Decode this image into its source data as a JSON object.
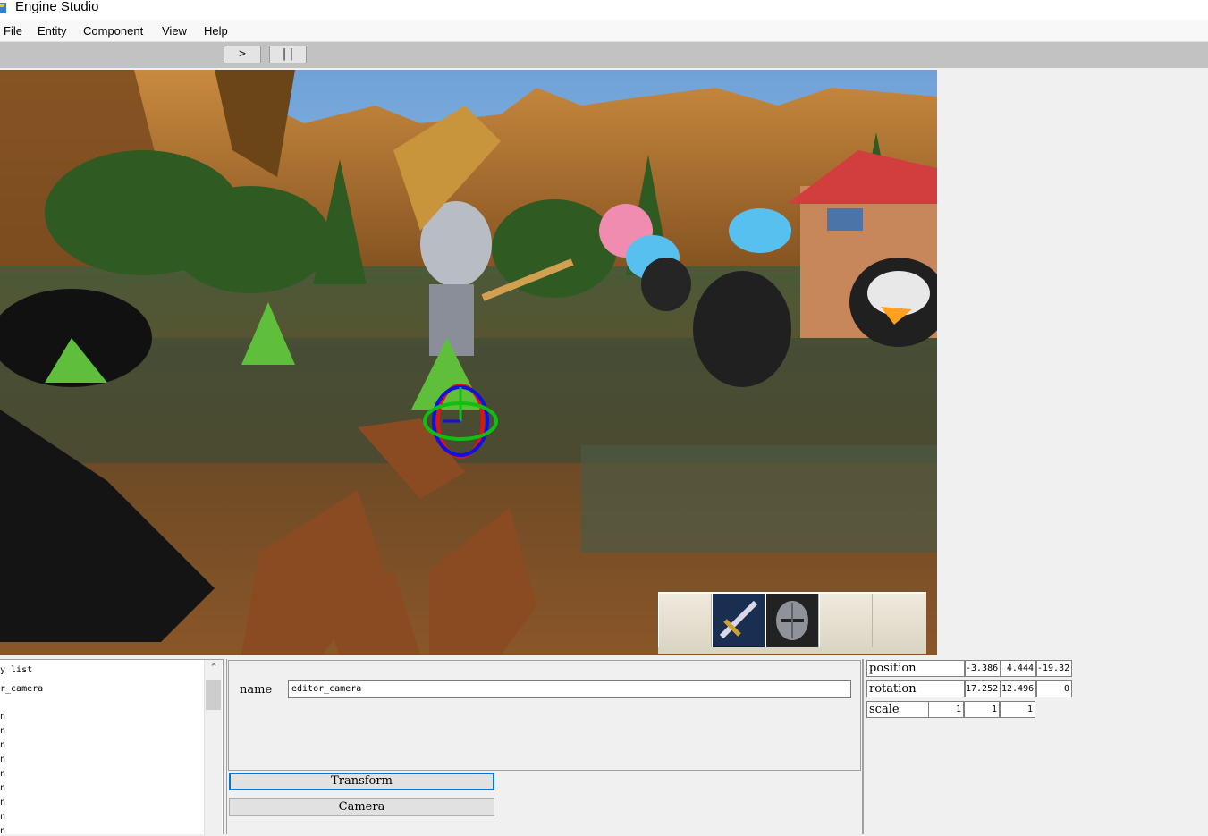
{
  "window": {
    "title": "Engine Studio"
  },
  "menu": {
    "items": [
      "File",
      "Entity",
      "Component",
      "View",
      "Help"
    ]
  },
  "toolbar": {
    "play_label": ">",
    "pause_label": "||"
  },
  "entity_list": {
    "header": "y list",
    "selected": "r_camera",
    "items": [
      "n",
      "n",
      "n",
      "n",
      "n",
      "n",
      "n",
      "n",
      "n",
      "n"
    ]
  },
  "properties": {
    "name_label": "name",
    "name_value": "editor_camera",
    "components": [
      "Transform",
      "Camera"
    ]
  },
  "transform": {
    "position": {
      "label": "position",
      "x": "-3.386",
      "y": "4.444",
      "z": "-19.32"
    },
    "rotation": {
      "label": "rotation",
      "x": "17.252",
      "y": "12.496",
      "z": "0"
    },
    "scale": {
      "label": "scale",
      "x": "1",
      "y": "1",
      "z": "1"
    }
  },
  "colors": {
    "accent": "#0078d7",
    "toolbar": "#c2c2c2",
    "gizmo_x": "#e81010",
    "gizmo_y": "#10c010",
    "gizmo_z": "#1010e0"
  },
  "icons": {
    "app": "app-icon",
    "hotbar": [
      "sword-icon",
      "helmet-icon"
    ]
  }
}
